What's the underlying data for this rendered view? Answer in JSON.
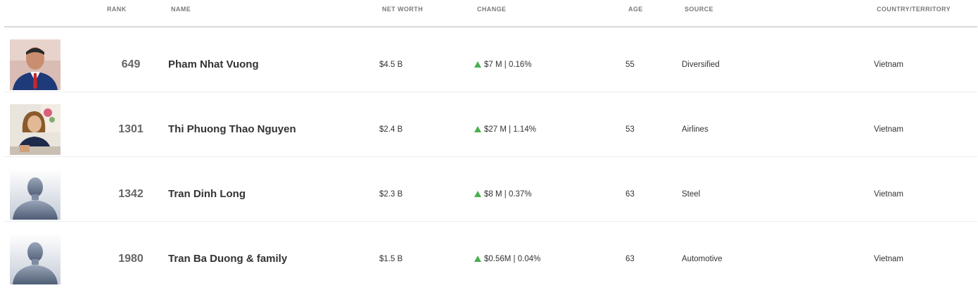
{
  "headers": {
    "rank": "RANK",
    "name": "NAME",
    "net_worth": "NET WORTH",
    "change": "CHANGE",
    "age": "AGE",
    "source": "SOURCE",
    "country": "COUNTRY/TERRITORY"
  },
  "rows": [
    {
      "photo": "person-photo",
      "rank": "649",
      "name": "Pham Nhat Vuong",
      "net_worth": "$4.5 B",
      "change_icon": "up-triangle-icon",
      "change": "$7 M | 0.16%",
      "age": "55",
      "source": "Diversified",
      "country": "Vietnam"
    },
    {
      "photo": "person-photo",
      "rank": "1301",
      "name": "Thi Phuong Thao Nguyen",
      "net_worth": "$2.4 B",
      "change_icon": "up-triangle-icon",
      "change": "$27 M | 1.14%",
      "age": "53",
      "source": "Airlines",
      "country": "Vietnam"
    },
    {
      "photo": "avatar-placeholder",
      "rank": "1342",
      "name": "Tran Dinh Long",
      "net_worth": "$2.3 B",
      "change_icon": "up-triangle-icon",
      "change": "$8 M | 0.37%",
      "age": "63",
      "source": "Steel",
      "country": "Vietnam"
    },
    {
      "photo": "avatar-placeholder",
      "rank": "1980",
      "name": "Tran Ba Duong & family",
      "net_worth": "$1.5 B",
      "change_icon": "up-triangle-icon",
      "change": "$0.56M | 0.04%",
      "age": "63",
      "source": "Automotive",
      "country": "Vietnam"
    }
  ],
  "colors": {
    "up": "#4caf50",
    "header_text": "#7a7a7a",
    "rank_text": "#666666",
    "body_text": "#333333"
  }
}
